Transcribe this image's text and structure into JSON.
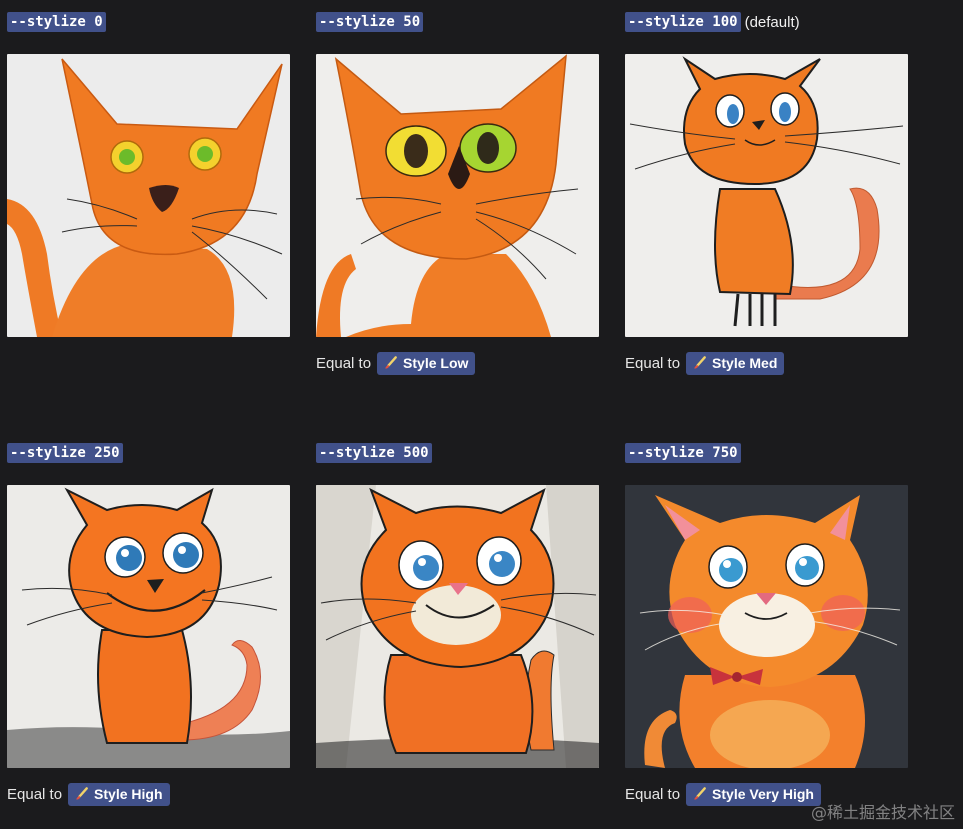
{
  "panels": [
    {
      "param": "--stylize 0",
      "note": "",
      "equal_label": "",
      "style_label": ""
    },
    {
      "param": "--stylize 50",
      "note": "",
      "equal_label": "Equal to",
      "style_label": "Style Low"
    },
    {
      "param": "--stylize 100",
      "note": "(default)",
      "equal_label": "Equal to",
      "style_label": "Style Med"
    },
    {
      "param": "--stylize 250",
      "note": "",
      "equal_label": "Equal to",
      "style_label": "Style High"
    },
    {
      "param": "--stylize 500",
      "note": "",
      "equal_label": "",
      "style_label": ""
    },
    {
      "param": "--stylize 750",
      "note": "",
      "equal_label": "Equal to",
      "style_label": "Style Very High"
    }
  ],
  "watermark": "@稀土掘金技术社区",
  "colors": {
    "background": "#1b1b1d",
    "tag": "#41518a",
    "cat_orange": "#f07a22"
  },
  "icons": {
    "style_pill": "paintbrush-icon"
  }
}
